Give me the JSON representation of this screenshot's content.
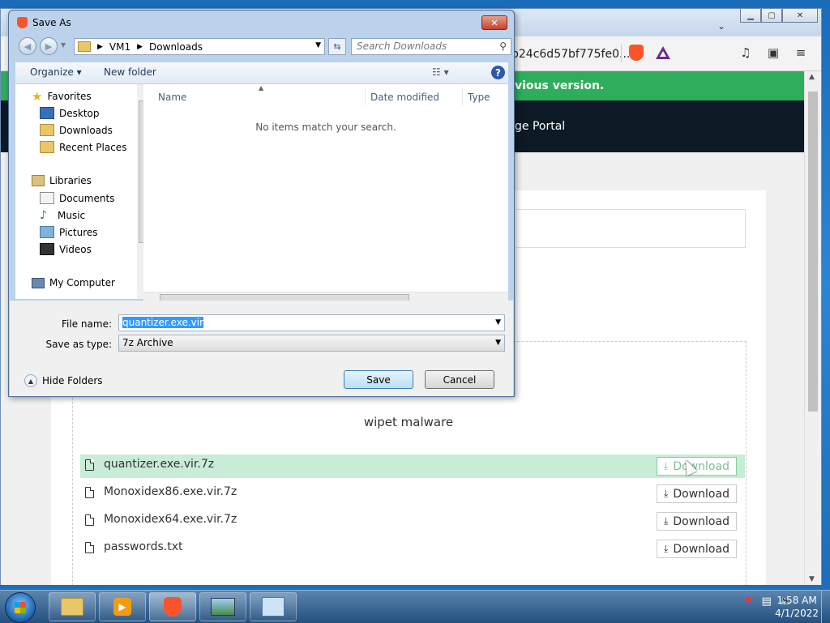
{
  "browser": {
    "url_fragment": "b24c6d57bf775fe0...",
    "banner_text": "vious version.",
    "nav_title": "ge Portal",
    "folder_title": "wipet malware",
    "files": [
      {
        "name": "quantizer.exe.vir.7z",
        "button": "Download"
      },
      {
        "name": "Monoxidex86.exe.vir.7z",
        "button": "Download"
      },
      {
        "name": "Monoxidex64.exe.vir.7z",
        "button": "Download"
      },
      {
        "name": "passwords.txt",
        "button": "Download"
      }
    ]
  },
  "dialog": {
    "title": "Save As",
    "breadcrumb": [
      "VM1",
      "Downloads"
    ],
    "search_placeholder": "Search Downloads",
    "organize_label": "Organize",
    "new_folder_label": "New folder",
    "nav": {
      "favorites": "Favorites",
      "favorite_items": [
        "Desktop",
        "Downloads",
        "Recent Places"
      ],
      "libraries": "Libraries",
      "library_items": [
        "Documents",
        "Music",
        "Pictures",
        "Videos"
      ],
      "computer": "My Computer"
    },
    "columns": [
      "Name",
      "Date modified",
      "Type"
    ],
    "empty_message": "No items match your search.",
    "file_name_label": "File name:",
    "file_name_value": "quantizer.exe.vir",
    "save_type_label": "Save as type:",
    "save_type_value": "7z Archive",
    "hide_folders_label": "Hide Folders",
    "save_button": "Save",
    "cancel_button": "Cancel"
  },
  "taskbar": {
    "time": "1:58 AM",
    "date": "4/1/2022"
  }
}
